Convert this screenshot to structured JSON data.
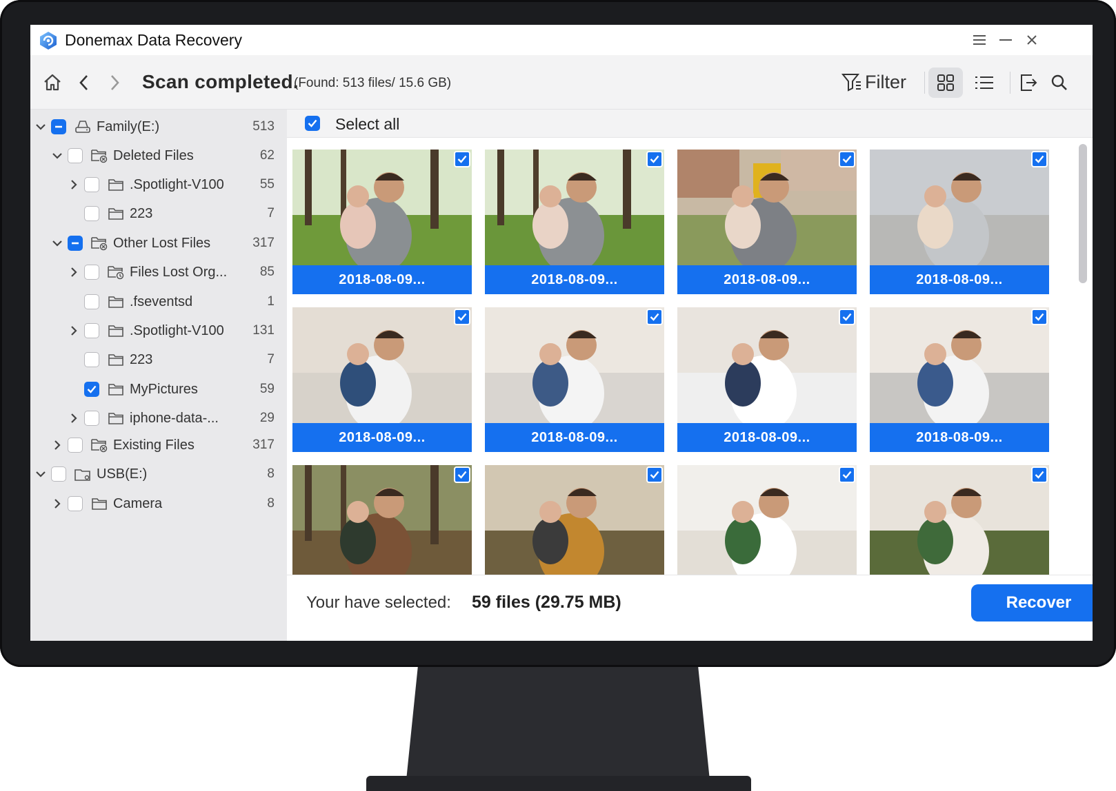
{
  "window": {
    "title": "Donemax Data Recovery",
    "controls": [
      "menu",
      "minimize",
      "close"
    ]
  },
  "toolbar": {
    "status": "Scan completed.",
    "found": "(Found: 513 files/ 15.6 GB)",
    "filter_label": "Filter",
    "active_view": "grid"
  },
  "sidebar": {
    "items": [
      {
        "label": "Family(E:)",
        "count": "513",
        "level": 0,
        "expand": "down",
        "check": "partial",
        "icon": "drive-icon"
      },
      {
        "label": "Deleted Files",
        "count": "62",
        "level": 1,
        "expand": "down",
        "check": "off",
        "icon": "deleted-folder-icon"
      },
      {
        "label": ".Spotlight-V100",
        "count": "55",
        "level": 2,
        "expand": "right",
        "check": "off",
        "icon": "folder-icon"
      },
      {
        "label": "223",
        "count": "7",
        "level": 2,
        "expand": "none",
        "check": "off",
        "icon": "folder-icon"
      },
      {
        "label": "Other Lost Files",
        "count": "317",
        "level": 1,
        "expand": "down",
        "check": "partial",
        "icon": "deleted-folder-icon"
      },
      {
        "label": "Files Lost Org...",
        "count": "85",
        "level": 2,
        "expand": "right",
        "check": "off",
        "icon": "lost-folder-icon"
      },
      {
        "label": ".fseventsd",
        "count": "1",
        "level": 2,
        "expand": "none",
        "check": "off",
        "icon": "folder-icon"
      },
      {
        "label": ".Spotlight-V100",
        "count": "131",
        "level": 2,
        "expand": "right",
        "check": "off",
        "icon": "folder-icon"
      },
      {
        "label": "223",
        "count": "7",
        "level": 2,
        "expand": "none",
        "check": "off",
        "icon": "folder-icon"
      },
      {
        "label": "MyPictures",
        "count": "59",
        "level": 2,
        "expand": "none",
        "check": "on",
        "icon": "folder-icon"
      },
      {
        "label": "iphone-data-...",
        "count": "29",
        "level": 2,
        "expand": "right",
        "check": "off",
        "icon": "folder-icon"
      },
      {
        "label": "Existing Files",
        "count": "317",
        "level": 1,
        "expand": "right",
        "check": "off",
        "icon": "deleted-folder-icon"
      },
      {
        "label": "USB(E:)",
        "count": "8",
        "level": 0,
        "expand": "down",
        "check": "off",
        "icon": "usb-drive-icon"
      },
      {
        "label": "Camera",
        "count": "8",
        "level": 1,
        "expand": "right",
        "check": "off",
        "icon": "folder-icon"
      }
    ]
  },
  "content": {
    "select_all_label": "Select all",
    "select_all_checked": true,
    "files": [
      {
        "name": "2018-08-09...",
        "checked": true,
        "scene": "father-daughter-park"
      },
      {
        "name": "2018-08-09...",
        "checked": true,
        "scene": "father-toddler-park"
      },
      {
        "name": "2018-08-09...",
        "checked": true,
        "scene": "playground"
      },
      {
        "name": "2018-08-09...",
        "checked": true,
        "scene": "father-baby-kiss"
      },
      {
        "name": "2018-08-09...",
        "checked": true,
        "scene": "boy-hug-father"
      },
      {
        "name": "2018-08-09...",
        "checked": true,
        "scene": "father-son-couch"
      },
      {
        "name": "2018-08-09...",
        "checked": true,
        "scene": "boy-shoulder"
      },
      {
        "name": "2018-08-09...",
        "checked": true,
        "scene": "boy-airplane"
      },
      {
        "name": "",
        "checked": true,
        "scene": "planting-tree"
      },
      {
        "name": "",
        "checked": true,
        "scene": "father-son-garden"
      },
      {
        "name": "",
        "checked": true,
        "scene": "boy-plants"
      },
      {
        "name": "",
        "checked": true,
        "scene": "boy-plant-pot"
      }
    ]
  },
  "footer": {
    "selected_label": "Your have selected:",
    "selected_value": "59 files (29.75 MB)",
    "recover_label": "Recover"
  },
  "colors": {
    "accent": "#1570ef",
    "sidebar_bg": "#e9e9eb",
    "toolbar_bg": "#f3f3f4"
  }
}
